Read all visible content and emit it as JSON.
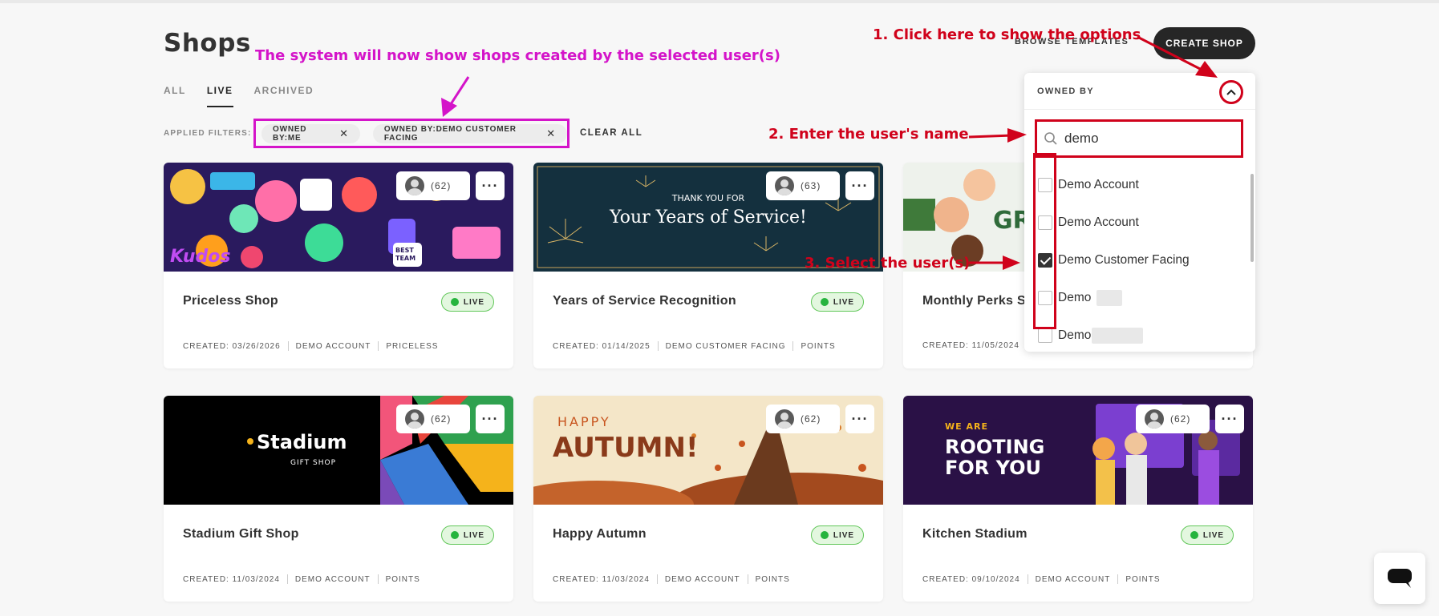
{
  "page": {
    "title": "Shops"
  },
  "header": {
    "browse_templates": "BROWSE TEMPLATES",
    "create_shop": "CREATE SHOP"
  },
  "tabs": [
    {
      "label": "ALL",
      "active": false
    },
    {
      "label": "LIVE",
      "active": true
    },
    {
      "label": "ARCHIVED",
      "active": false
    }
  ],
  "filters": {
    "label": "APPLIED FILTERS:",
    "chips": [
      "OWNED BY:ME",
      "OWNED BY:DEMO CUSTOMER FACING"
    ],
    "clear_all": "CLEAR ALL"
  },
  "dropdown": {
    "label": "OWNED BY",
    "search_value": "demo",
    "options": [
      {
        "label": "Demo Account",
        "checked": false
      },
      {
        "label": "Demo Account",
        "checked": false
      },
      {
        "label": "Demo Customer Facing",
        "checked": true
      },
      {
        "label": "Demo",
        "checked": false
      },
      {
        "label": "Demo",
        "checked": false
      }
    ]
  },
  "annotations": {
    "step1": "1. Click here to show the options",
    "step2": "2. Enter the user's name",
    "step3": "3. Select the user(s)",
    "note": "The system will now show shops created by the selected user(s)"
  },
  "cards": [
    {
      "title": "Priceless Shop",
      "status": "LIVE",
      "owners": "(62)",
      "created": "CREATED: 03/26/2026",
      "owner": "DEMO ACCOUNT",
      "type": "PRICELESS",
      "art": "Kudos",
      "art2": "BEST TEAM EVER"
    },
    {
      "title": "Years of Service Recognition",
      "status": "LIVE",
      "owners": "(63)",
      "created": "CREATED: 01/14/2025",
      "owner": "DEMO CUSTOMER FACING",
      "type": "POINTS",
      "art_small": "THANK YOU FOR",
      "art": "Your Years of Service!"
    },
    {
      "title": "Monthly Perks Sh",
      "status": "LIVE",
      "owners": "",
      "created": "CREATED: 11/05/2024",
      "owner": "",
      "type": "",
      "art": "GR"
    },
    {
      "title": "Stadium Gift Shop",
      "status": "LIVE",
      "owners": "(62)",
      "created": "CREATED: 11/03/2024",
      "owner": "DEMO ACCOUNT",
      "type": "POINTS",
      "art": "Stadium",
      "art2": "GIFT SHOP"
    },
    {
      "title": "Happy Autumn",
      "status": "LIVE",
      "owners": "(62)",
      "created": "CREATED: 11/03/2024",
      "owner": "DEMO ACCOUNT",
      "type": "POINTS",
      "art_small": "HAPPY",
      "art": "AUTUMN!"
    },
    {
      "title": "Kitchen Stadium",
      "status": "LIVE",
      "owners": "(62)",
      "created": "CREATED: 09/10/2024",
      "owner": "DEMO ACCOUNT",
      "type": "POINTS",
      "art_small": "WE ARE",
      "art": "ROOTING",
      "art2": "FOR YOU"
    }
  ],
  "colors": {
    "annotation_red": "#d0021b",
    "annotation_magenta": "#d414c9",
    "live_green": "#26b43e",
    "dark_button": "#262626"
  }
}
